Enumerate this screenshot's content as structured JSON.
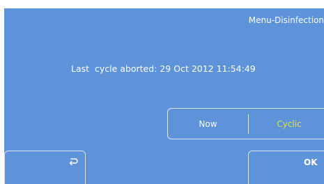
{
  "header": {
    "title": "Menu-Disinfection"
  },
  "status": {
    "last_cycle_text": "Last  cycle aborted: 29 Oct 2012 11:54:49"
  },
  "mode": {
    "now_label": "Now",
    "cyclic_label": "Cyclic",
    "selected": "Cyclic"
  },
  "buttons": {
    "back_icon": "return-arrow-icon",
    "ok_label": "OK"
  },
  "colors": {
    "panel_bg": "#5f93d9",
    "text": "#ffffff",
    "selected_text": "#d9e05a",
    "border": "#d9e6f8"
  }
}
